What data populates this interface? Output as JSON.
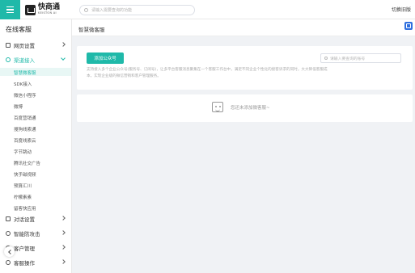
{
  "header": {
    "logo_cn": "快商通",
    "logo_en": "KEISTON AI",
    "search_placeholder": "请输入需要查询的功能",
    "switch_label": "切换旧版"
  },
  "sidebar": {
    "title": "在线客服",
    "groups": [
      {
        "label": "网页设置",
        "icon": "page-icon",
        "expanded": false
      },
      {
        "label": "渠道接入",
        "icon": "channel-icon",
        "expanded": true
      },
      {
        "label": "对话设置",
        "icon": "dialog-icon",
        "expanded": false
      },
      {
        "label": "智能防攻击",
        "icon": "shield-icon",
        "expanded": false
      },
      {
        "label": "客户管理",
        "icon": "user-icon",
        "expanded": false
      },
      {
        "label": "客服操作",
        "icon": "agent-icon",
        "expanded": false
      }
    ],
    "channel_items": [
      "智慧微客服",
      "SDK接入",
      "微信小程序",
      "微博",
      "百度营销通",
      "搜狗线索通",
      "百度线索云",
      "字节跳动",
      "腾讯社交广告",
      "快手磁视频",
      "预算汇川",
      "柠檬素素",
      "留客快应用"
    ],
    "active_item_index": 0
  },
  "main": {
    "page_title": "智慧微客服",
    "add_button": "添加公众号",
    "account_search_placeholder": "请输入要查询的账号",
    "description": "支持接入多个企业公众号(服务号、订阅号)，让多平台客服消息聚集在一个客服工作台中，满足不同企业个性化的接客诉求的同时，大大降低客服成本，实现企业级的微信营销和客户管理服务。",
    "empty_text": "您还未添加微客服~"
  },
  "colors": {
    "accent": "#1fb9a9",
    "corner_icon": "#2f6fde"
  }
}
